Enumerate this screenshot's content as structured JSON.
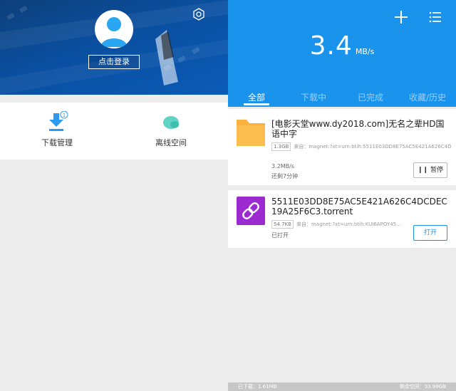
{
  "left": {
    "login_label": "点击登录",
    "menu": [
      {
        "label": "下载管理",
        "badge": "1",
        "icon": "download-icon"
      },
      {
        "label": "离线空间",
        "icon": "cloud-icon"
      }
    ]
  },
  "right": {
    "speed": {
      "value": "3.4",
      "unit": "MB/s"
    },
    "tabs": [
      "全部",
      "下载中",
      "已完成",
      "收藏/历史"
    ],
    "active_tab": "全部",
    "items": [
      {
        "name": "[电影天堂www.dy2018.com]无名之辈HD国语中字",
        "size": "1.3GB",
        "source": "来自：magnet:?xt=urn:btih:5511E03DD8E75AC5E421A626C4DC...",
        "speed": "3.2MB/s",
        "remaining": "还剩7分钟",
        "action": "暂停",
        "icon": "folder-icon"
      },
      {
        "name": "5511E03DD8E75AC5E421A626C4DCDEC19A25F6C3.torrent",
        "size": "54.7KB",
        "source": "来自：magnet:?xt=urn:btih:KUI6APOY45...",
        "status": "已打开",
        "action": "打开",
        "icon": "link-icon"
      }
    ],
    "footer": {
      "downloaded": "已下载：1.61MB",
      "free": "剩余空间：33.99GB"
    }
  },
  "colors": {
    "accent": "#1a93ec",
    "hero": "#0b5bb7",
    "folder": "#fbb13c",
    "torrent": "#9b2bd0"
  }
}
